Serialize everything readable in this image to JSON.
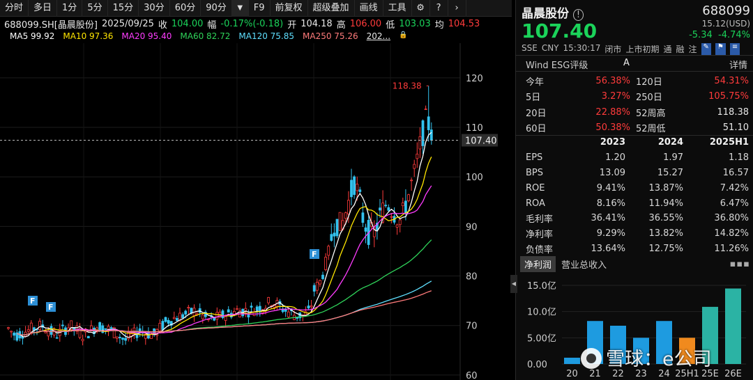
{
  "toolbar": {
    "items": [
      "分时",
      "多日",
      "1分",
      "5分",
      "15分",
      "30分",
      "60分",
      "90分"
    ],
    "dropdown_icon": "triangle-down-icon",
    "tools": [
      "F9",
      "前复权",
      "超级叠加",
      "画线",
      "工具"
    ],
    "settings_icon": "gear-icon",
    "help_icon": "help-icon",
    "more_icon": "chevron-right-icon"
  },
  "info": {
    "symbol": "688099.SH[晶晨股份]",
    "date": "2025/09/25",
    "close_label": "收",
    "close": "104.00",
    "range_label": "幅",
    "range": "-0.17%(-0.18)",
    "open_label": "开",
    "open": "104.18",
    "high_label": "高",
    "high": "106.00",
    "low_label": "低",
    "low": "103.03",
    "avg_label": "均",
    "avg": "104.53"
  },
  "ma": [
    {
      "label": "MA5 99.92",
      "color": "#ffffff"
    },
    {
      "label": "MA10 97.36",
      "color": "#ffe600"
    },
    {
      "label": "MA20 95.40",
      "color": "#ff3cff"
    },
    {
      "label": "MA60 82.72",
      "color": "#2fd35a"
    },
    {
      "label": "MA120 75.85",
      "color": "#5fe0ff"
    },
    {
      "label": "MA250 75.26",
      "color": "#ff7b7b"
    }
  ],
  "ma_more": "202...",
  "ma_lock_icon": "lock-icon",
  "chart_data": {
    "type": "candlestick",
    "y_axis_ticks": [
      120,
      110,
      100,
      90,
      80,
      70,
      60
    ],
    "ylim": [
      59,
      127
    ],
    "current_price_label": "107.40",
    "max_label": "118.38",
    "event_flag": "F",
    "logo": "WP"
  },
  "panel": {
    "name": "晶晨股份",
    "info_icon": "info-icon",
    "code": "688099",
    "price": "107.40",
    "usd": "15.12(USD)",
    "change": "-5.34",
    "change_pct": "-4.74%",
    "market": "SSE",
    "currency": "CNY",
    "time": "15:30:17",
    "status": "闭市",
    "stage": "上市初期",
    "tags": [
      "通",
      "融",
      "注"
    ],
    "pen_icon": "pen-icon",
    "flag_icon": "flag-icon",
    "menu_icon": "menu-icon",
    "esg_label": "Wind ESG评级",
    "esg_value": "A",
    "esg_more": "详情",
    "perf": [
      [
        "今年",
        "56.38%",
        "120日",
        "54.31%"
      ],
      [
        "5日",
        "3.27%",
        "250日",
        "105.75%"
      ],
      [
        "20日",
        "22.88%",
        "52周高",
        "118.38"
      ],
      [
        "60日",
        "50.38%",
        "52周低",
        "51.10"
      ]
    ],
    "fin_headers": [
      "",
      "2023",
      "2024",
      "2025H1"
    ],
    "fin_rows": [
      [
        "EPS",
        "1.20",
        "1.97",
        "1.18"
      ],
      [
        "BPS",
        "13.09",
        "15.27",
        "16.57"
      ],
      [
        "ROE",
        "9.41%",
        "13.87%",
        "7.42%"
      ],
      [
        "ROA",
        "8.16%",
        "11.94%",
        "6.47%"
      ],
      [
        "毛利率",
        "36.41%",
        "36.55%",
        "36.80%"
      ],
      [
        "净利率",
        "9.29%",
        "13.82%",
        "14.82%"
      ],
      [
        "负债率",
        "13.64%",
        "12.75%",
        "11.26%"
      ]
    ],
    "tab_active": "净利润",
    "tab_other": "营业总收入",
    "tab_dots": "▪▪▪",
    "collapse_icon": "collapse-left-icon"
  },
  "net_profit_chart": {
    "type": "bar",
    "categories": [
      "20",
      "21",
      "22",
      "23",
      "24",
      "25H1",
      "25E",
      "26E"
    ],
    "values": [
      1.2,
      8.2,
      7.3,
      5.0,
      8.2,
      5.0,
      10.9,
      14.4
    ],
    "colors": [
      "#1e9be0",
      "#1e9be0",
      "#1e9be0",
      "#1e9be0",
      "#1e9be0",
      "#f08a1e",
      "#2bb3a4",
      "#2bb3a4"
    ],
    "y_ticks": [
      "15.0亿",
      "10.0亿",
      "5.00亿",
      "0.00"
    ],
    "ylim": [
      0,
      15
    ]
  },
  "watermark": "雪球：e公司"
}
